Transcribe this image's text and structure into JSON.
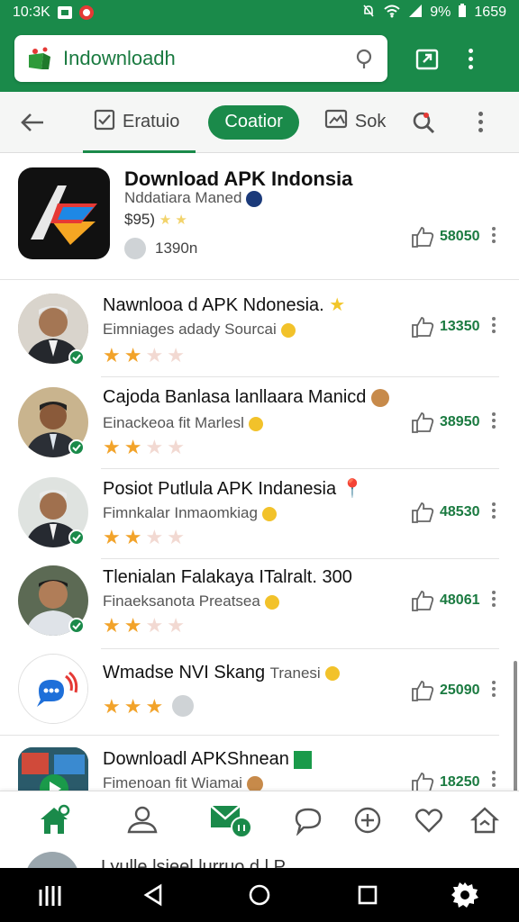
{
  "status_bar": {
    "time": "10:3K",
    "battery": "9%",
    "clock_right": "1659",
    "icons": [
      "notification-box-icon",
      "record-icon",
      "mute-icon",
      "wifi-icon",
      "signal-icon",
      "battery-icon"
    ]
  },
  "app_bar": {
    "search_query": "Indownloadh",
    "icons": [
      "app-logo-icon",
      "location-pin-icon",
      "open-in-app-icon",
      "overflow-menu-icon"
    ]
  },
  "tabs": {
    "tab1_label": "Eratuio",
    "chip_label": "Coatior",
    "tab3_label": "Sok"
  },
  "featured": {
    "title": "Download APK Indonsia",
    "developer": "Nddatiara Maned",
    "price": "$95)",
    "downloads": "1390n",
    "likes": "58050"
  },
  "items": [
    {
      "title": "Nawnlooa d APK Ndonesia.",
      "subtitle": "Eimniages adady Sourcai",
      "rating": 2,
      "likes": "13350"
    },
    {
      "title": "Cajoda Banlasa lanllaara Manicd",
      "subtitle": "Einackeoa fit Marlesl",
      "rating": 2,
      "likes": "38950"
    },
    {
      "title": "Posiot Putlula APK Indanesia",
      "subtitle": "Fimnkalar Inmaomkiag",
      "rating": 2,
      "likes": "48530"
    },
    {
      "title": "Tlenialan Falakaya ITalralt.  300",
      "subtitle": "Finaeksanota Preatsea",
      "rating": 2,
      "likes": "48061"
    },
    {
      "title": "Wmadse NVI Skang",
      "title_suffix": "Tranesi",
      "rating": 3,
      "likes": "25090"
    },
    {
      "title": "Downloadl APKShnean",
      "subtitle": "Fimenoan fit Wiamai",
      "likes": "18250"
    }
  ],
  "peek_text": "Lyulle lsieel lurruo  d.l P.",
  "bottom_nav": [
    "home-icon",
    "profile-icon",
    "inbox-icon",
    "chat-icon",
    "add-icon",
    "favorite-icon",
    "house-outline-icon"
  ],
  "colors": {
    "primary": "#1a8a4a",
    "accent_text": "#1a7a40",
    "star": "#f2a32a"
  }
}
